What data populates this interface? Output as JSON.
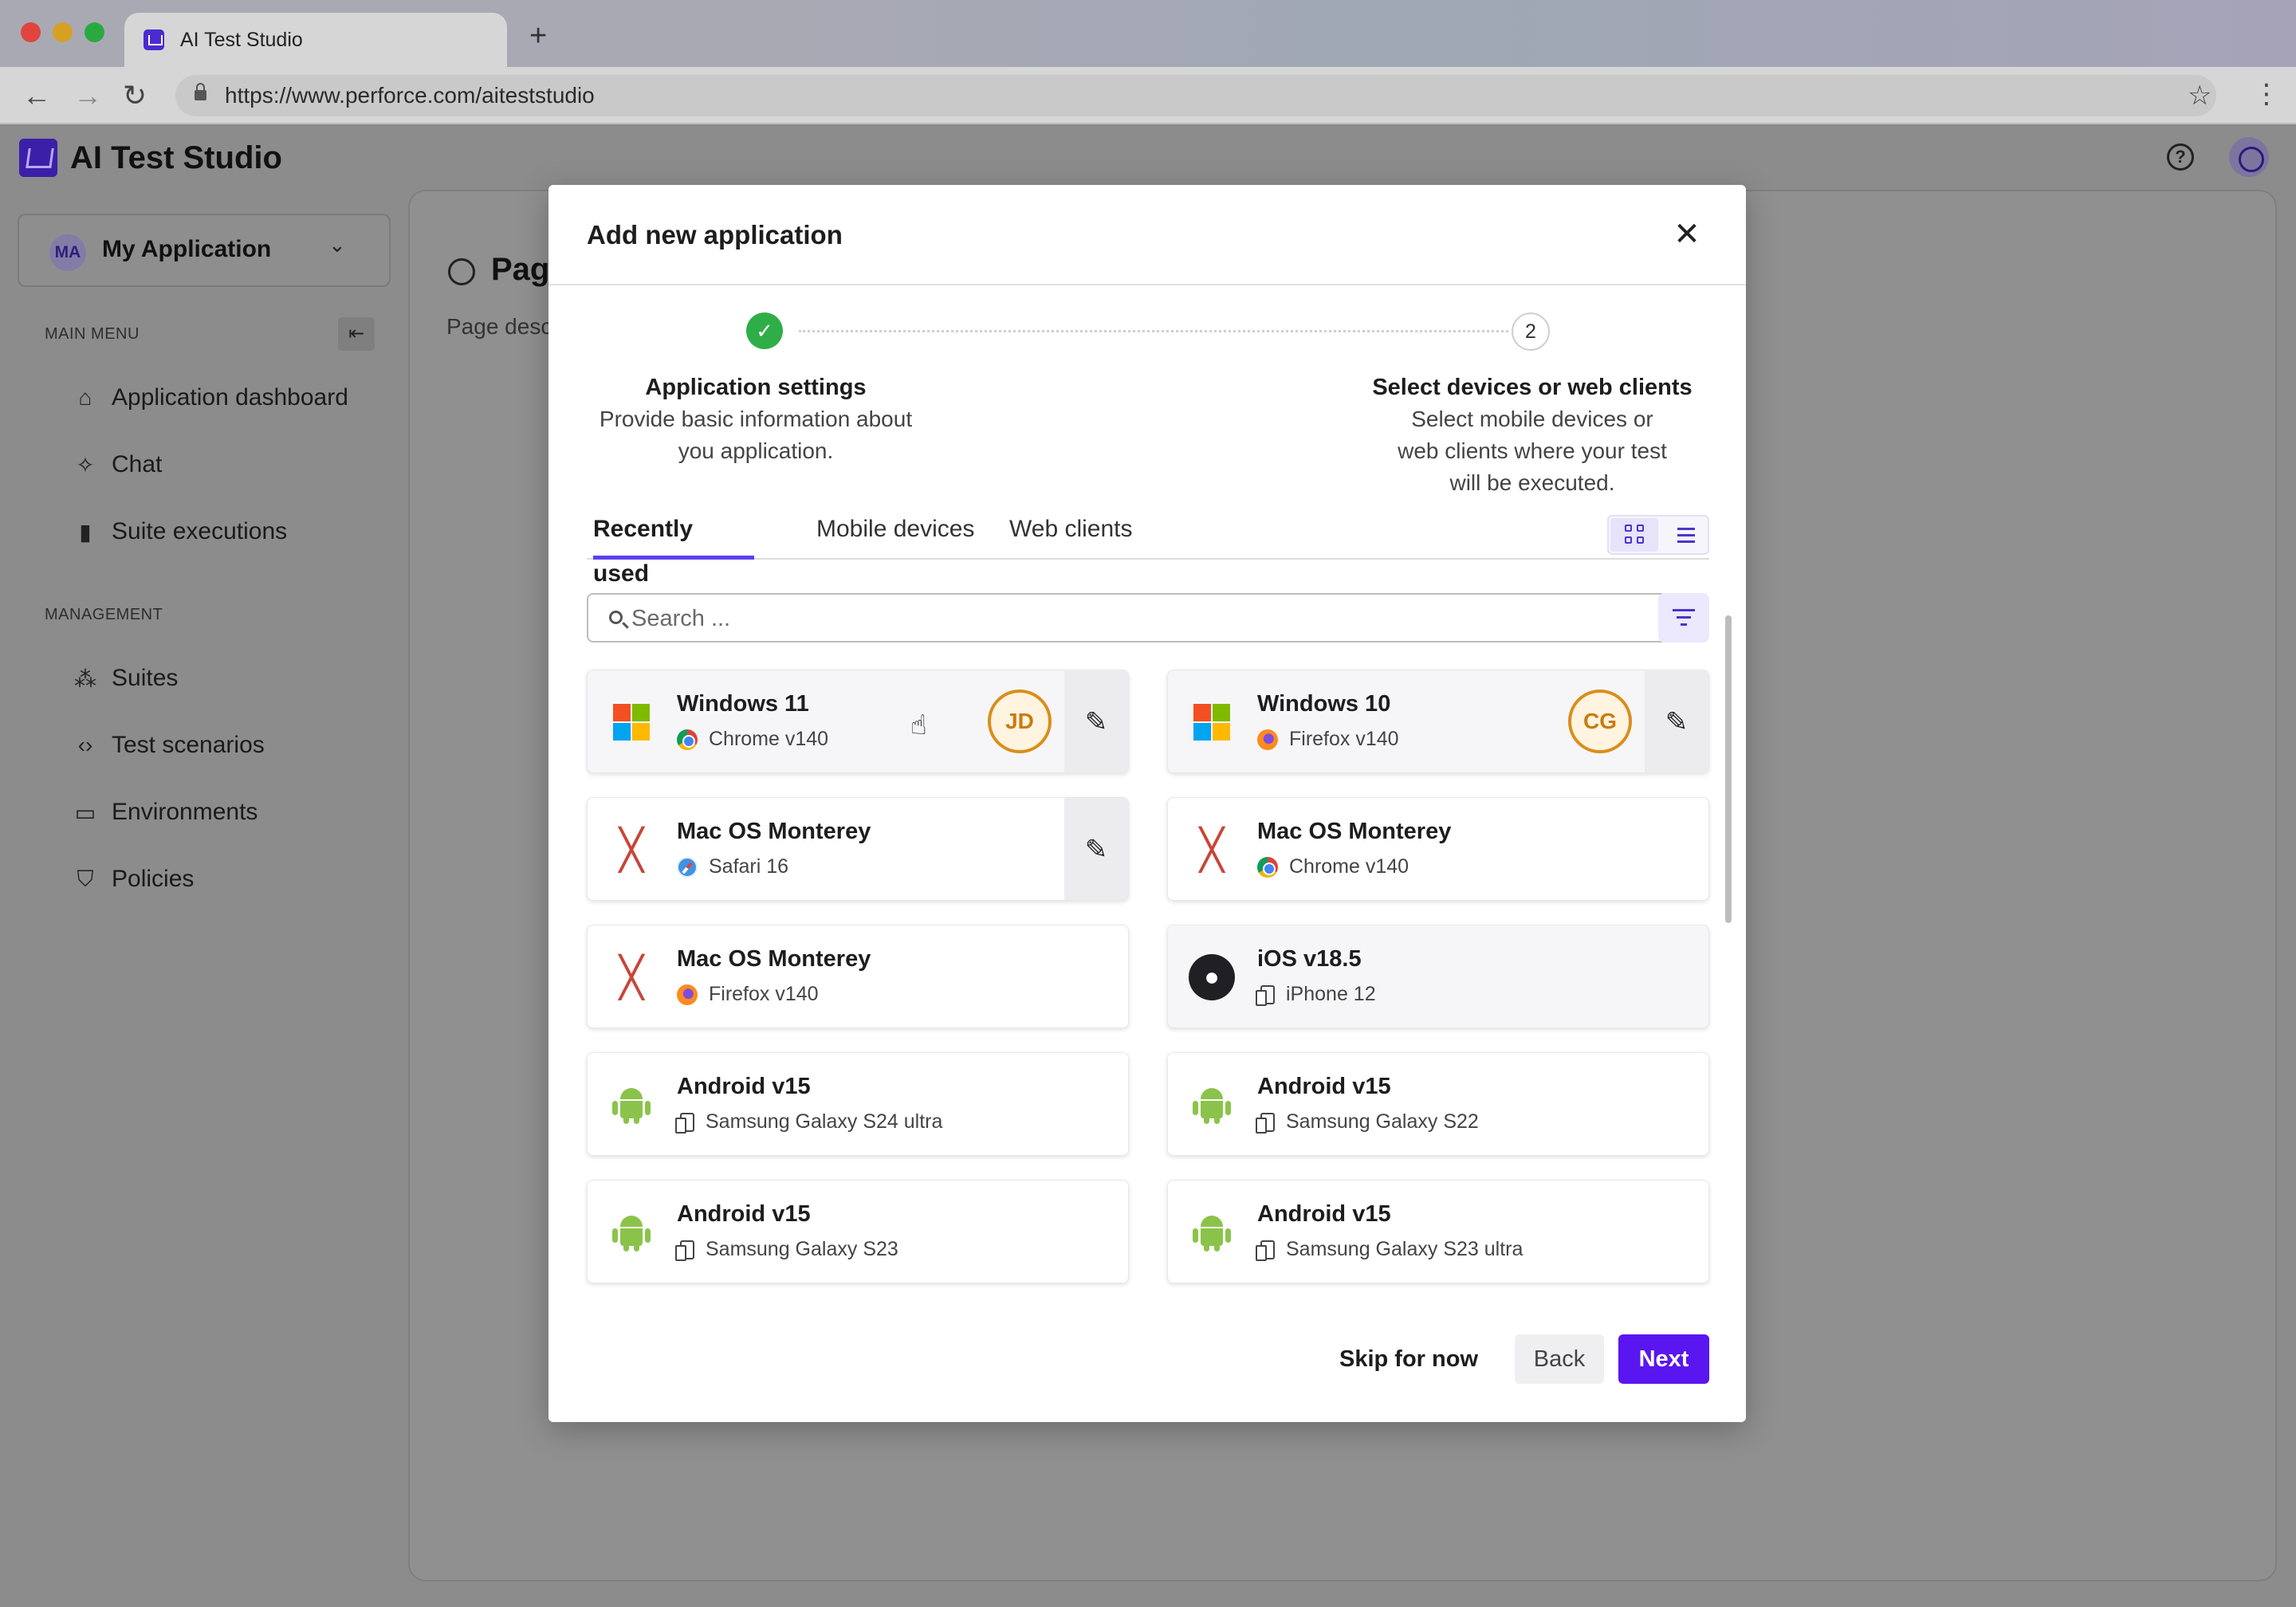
{
  "browser": {
    "tab_title": "AI Test Studio",
    "new_tab": "+",
    "url": "https://www.perforce.com/aiteststudio"
  },
  "app": {
    "title": "AI Test Studio",
    "app_selector": {
      "avatar": "MA",
      "label": "My Application"
    },
    "main_menu_label": "MAIN MENU",
    "main_menu": [
      {
        "label": "Application dashboard",
        "icon": "home-icon"
      },
      {
        "label": "Chat",
        "icon": "sparkle-icon"
      },
      {
        "label": "Suite executions",
        "icon": "bar-chart-icon"
      }
    ],
    "management_label": "MANAGEMENT",
    "management": [
      {
        "label": "Suites",
        "icon": "nodes-icon"
      },
      {
        "label": "Test scenarios",
        "icon": "code-icon"
      },
      {
        "label": "Environments",
        "icon": "devices-icon"
      },
      {
        "label": "Policies",
        "icon": "shield-icon"
      }
    ],
    "page_title": "Pag",
    "page_desc": "Page desc"
  },
  "modal": {
    "title": "Add new application",
    "steps": [
      {
        "number": "1",
        "title": "Application settings",
        "desc": "Provide basic information about you application.",
        "status": "complete"
      },
      {
        "number": "2",
        "title": "Select devices or web clients",
        "desc": "Select mobile devices or web clients where your test will be executed.",
        "status": "current"
      }
    ],
    "tabs": [
      {
        "label": "Recently used",
        "active": true
      },
      {
        "label": "Mobile devices",
        "active": false
      },
      {
        "label": "Web clients",
        "active": false
      }
    ],
    "search_placeholder": "Search ...",
    "cards": [
      {
        "title": "Windows 11",
        "sub": "Chrome v140",
        "os": "windows-icon",
        "client": "chrome-icon",
        "avatar": "JD",
        "editable": true
      },
      {
        "title": "Windows 10",
        "sub": "Firefox v140",
        "os": "windows-icon",
        "client": "firefox-icon",
        "avatar": "CG",
        "editable": true
      },
      {
        "title": "Mac OS Monterey",
        "sub": "Safari 16",
        "os": "macos-icon",
        "client": "safari-icon",
        "editable": true
      },
      {
        "title": "Mac OS Monterey",
        "sub": "Chrome v140",
        "os": "macos-icon",
        "client": "chrome-icon"
      },
      {
        "title": "Mac OS Monterey",
        "sub": "Firefox v140",
        "os": "macos-icon",
        "client": "firefox-icon"
      },
      {
        "title": "iOS v18.5",
        "sub": "iPhone 12",
        "os": "apple-icon",
        "client": "device-icon"
      },
      {
        "title": "Android v15",
        "sub": "Samsung Galaxy S24 ultra",
        "os": "android-icon",
        "client": "device-icon"
      },
      {
        "title": "Android v15",
        "sub": "Samsung Galaxy S22",
        "os": "android-icon",
        "client": "device-icon"
      },
      {
        "title": "Android v15",
        "sub": "Samsung Galaxy S23",
        "os": "android-icon",
        "client": "device-icon"
      },
      {
        "title": "Android v15",
        "sub": "Samsung Galaxy S23 ultra",
        "os": "android-icon",
        "client": "device-icon"
      }
    ],
    "footer": {
      "skip": "Skip for now",
      "back": "Back",
      "next": "Next"
    }
  },
  "colors": {
    "accent": "#5a16f0",
    "step_complete": "#2fae47",
    "avatar_border": "#d98e1c",
    "overlay": "#8c8c8c"
  }
}
